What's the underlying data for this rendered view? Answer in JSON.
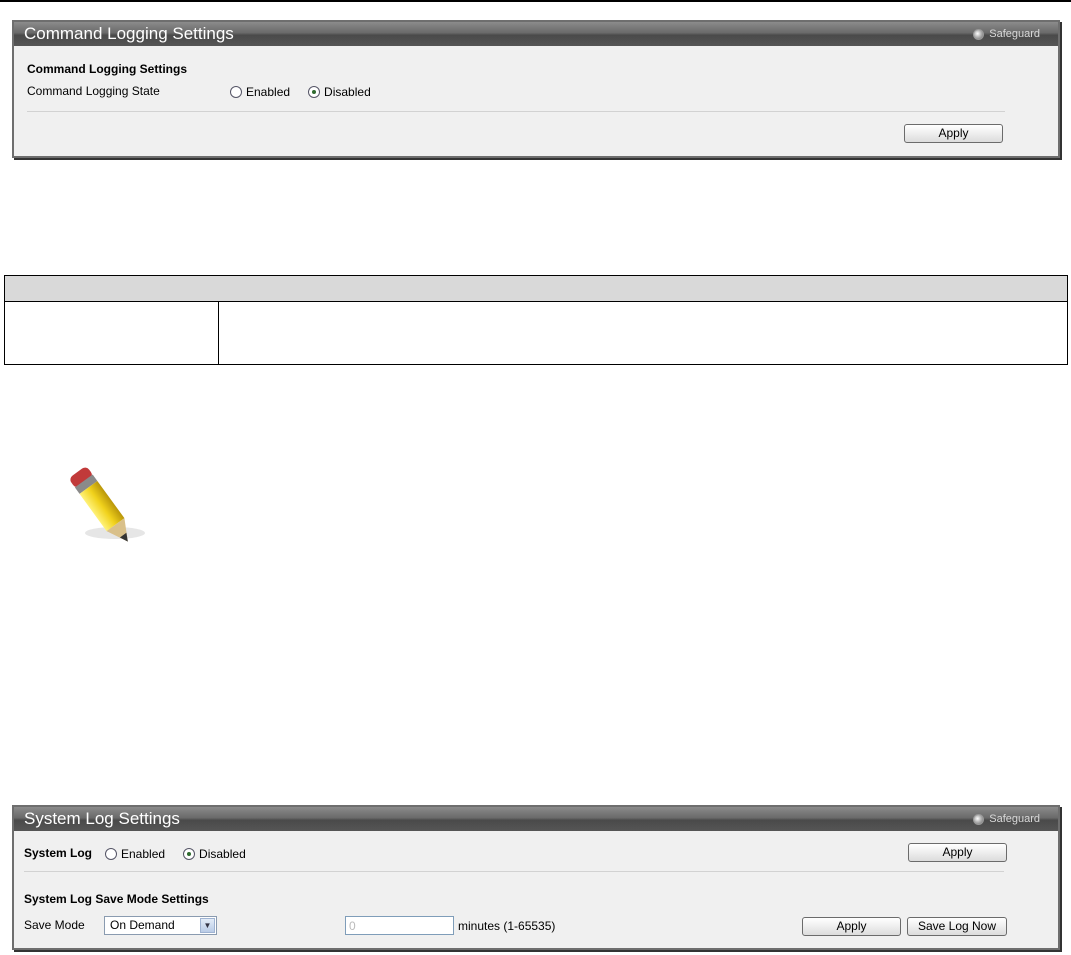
{
  "command_logging_panel": {
    "title": "Command Logging Settings",
    "safeguard_label": "Safeguard",
    "section_heading": "Command Logging Settings",
    "state_label": "Command Logging State",
    "options": [
      "Enabled",
      "Disabled"
    ],
    "selected": "Disabled",
    "apply_label": "Apply"
  },
  "doc_table": {
    "header": "",
    "row": [
      "",
      ""
    ]
  },
  "note": {
    "icon": "pencil-icon"
  },
  "system_log_panel": {
    "title": "System Log Settings",
    "safeguard_label": "Safeguard",
    "system_log_label": "System Log",
    "options": [
      "Enabled",
      "Disabled"
    ],
    "selected": "Disabled",
    "apply_label": "Apply",
    "save_mode_heading": "System Log Save Mode Settings",
    "save_mode_label": "Save Mode",
    "save_mode_value": "On Demand",
    "minutes_value": "0",
    "minutes_unit": "minutes (1-65535)",
    "apply2_label": "Apply",
    "save_log_now_label": "Save Log Now"
  }
}
